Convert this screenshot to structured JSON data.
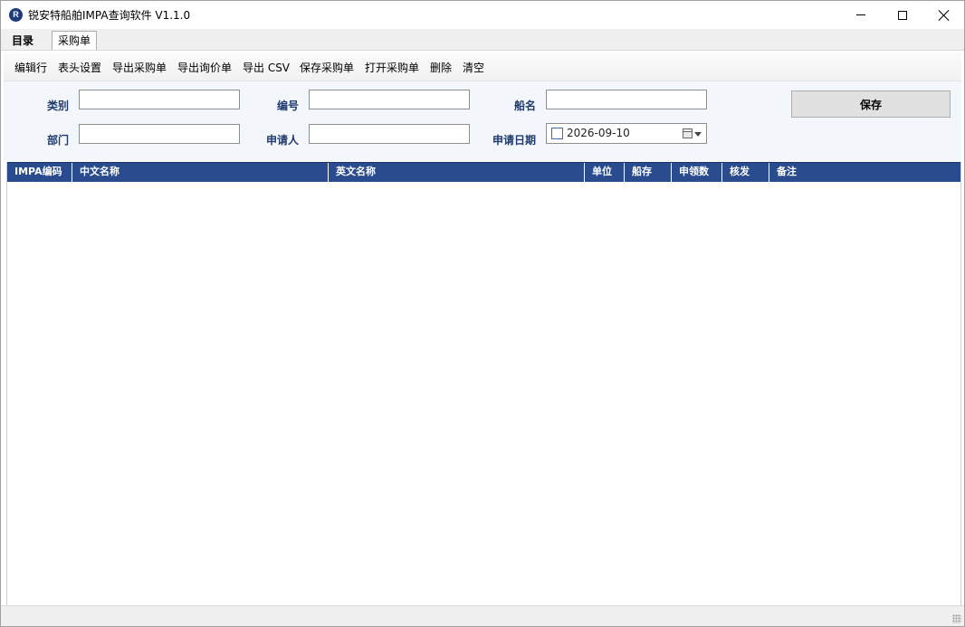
{
  "window": {
    "title": "锐安特船舶IMPA查询软件 V1.1.0",
    "icon_letter": "R"
  },
  "tabs": [
    {
      "label": "目录",
      "active": false
    },
    {
      "label": "采购单",
      "active": true
    }
  ],
  "toolbar": {
    "items": [
      "编辑行",
      "表头设置",
      "导出采购单",
      "导出询价单",
      "导出 CSV",
      "保存采购单",
      "打开采购单",
      "删除",
      "清空"
    ]
  },
  "form": {
    "category_label": "类别",
    "category_value": "",
    "number_label": "编号",
    "number_value": "",
    "ship_label": "船名",
    "ship_value": "",
    "department_label": "部门",
    "department_value": "",
    "applicant_label": "申请人",
    "applicant_value": "",
    "date_label": "申请日期",
    "date_value": "2026-09-10",
    "save_label": "保存"
  },
  "grid": {
    "columns": [
      "IMPA编码",
      "中文名称",
      "英文名称",
      "单位",
      "船存",
      "申领数",
      "核发",
      "备注"
    ],
    "rows": []
  },
  "colors": {
    "header_bg": "#2a4b8d",
    "label_color": "#1f3b6f",
    "form_bg": "#f3f6fa"
  }
}
